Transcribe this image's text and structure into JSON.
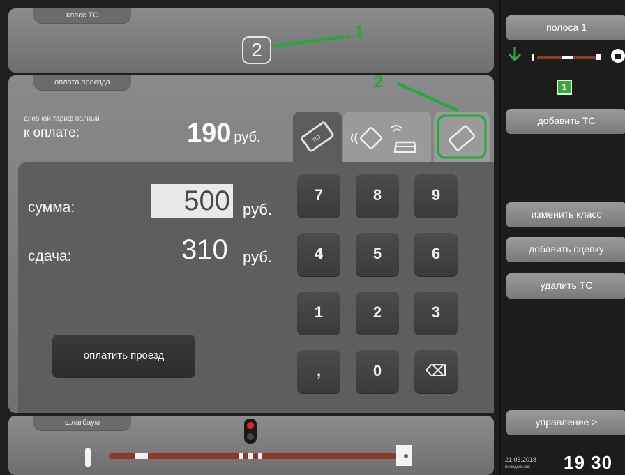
{
  "vehicle_class": {
    "section_label": "класс ТС",
    "value": "2"
  },
  "payment": {
    "section_label": "оплата проезда",
    "tariff_label": "дневной тариф полный",
    "to_pay_label": "к оплате:",
    "to_pay_amount": "190",
    "currency": "руб.",
    "sum_label": "сумма:",
    "sum_value": "500",
    "change_label": "сдача:",
    "change_value": "310",
    "pay_button_label": "оплатить проезд",
    "methods": [
      "bank-card-icon",
      "contactless-tag-icon",
      "transponder-card-icon"
    ]
  },
  "keypad": {
    "keys": [
      "7",
      "8",
      "9",
      "4",
      "5",
      "6",
      "1",
      "2",
      "3",
      ",",
      "0",
      "⌫"
    ]
  },
  "barrier": {
    "section_label": "шлагбаум"
  },
  "sidebar": {
    "lane_label": "полоса 1",
    "lane_badge": "1",
    "add_vehicle": "добавить ТС",
    "change_class": "изменить класс",
    "add_trailer": "добавить сцепку",
    "remove_vehicle": "удалить ТС",
    "control": "управление >",
    "date": "21.05.2018",
    "weekday": "понедельник",
    "time_hours": "19",
    "time_minutes": "30"
  },
  "annotations": {
    "marker1": "1",
    "marker2": "2"
  },
  "colors": {
    "annotation_green": "#1faa3a",
    "lane_green": "#3fa33f",
    "barrier_red": "#d42a2a",
    "barrier_arm": "#8b3a2a"
  }
}
